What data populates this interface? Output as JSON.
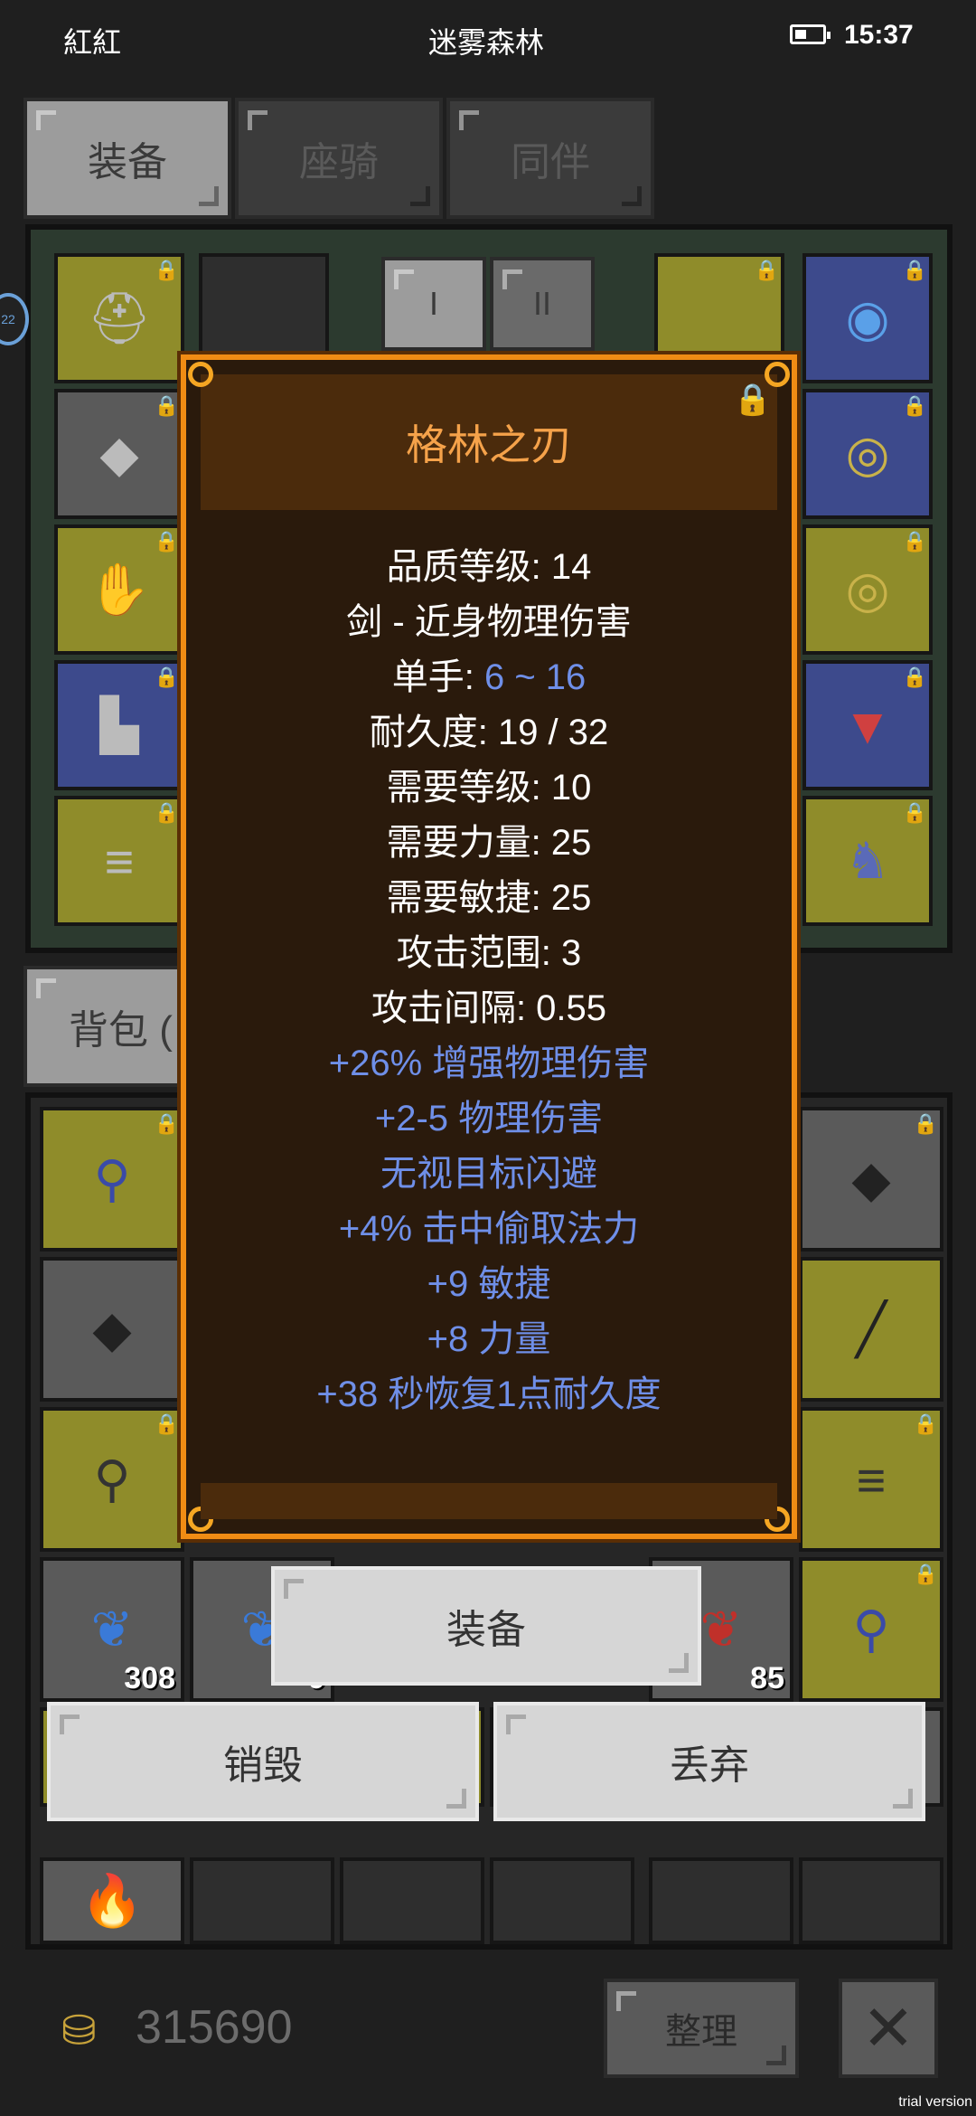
{
  "status_bar": {
    "player_name": "紅紅",
    "location": "迷雾森林",
    "time": "15:37"
  },
  "tabs": [
    {
      "label": "装备"
    },
    {
      "label": "座骑"
    },
    {
      "label": "同伴"
    }
  ],
  "equip_page_buttons": {
    "page1": "I",
    "page2": "II"
  },
  "bag_tab": {
    "label": "背包 ("
  },
  "side_badge": "22",
  "item_popup": {
    "name": "格林之刃",
    "quality_label": "品质等级: 14",
    "type_label": "剑 - 近身物理伤害",
    "hand_label": "单手: ",
    "damage": "6 ~ 16",
    "durability_label": "耐久度: 19 / 32",
    "req_level_label": "需要等级: 10",
    "req_str_label": "需要力量: 25",
    "req_dex_label": "需要敏捷: 25",
    "range_label": "攻击范围: 3",
    "interval_label": "攻击间隔: 0.55",
    "affixes": [
      "+26% 增强物理伤害",
      "+2-5 物理伤害",
      "无视目标闪避",
      "+4% 击中偷取法力",
      "+9 敏捷",
      "+8 力量",
      "+38 秒恢复1点耐久度"
    ]
  },
  "actions": {
    "equip": "装备",
    "destroy": "销毁",
    "discard": "丢弃"
  },
  "bag_counts": {
    "left_wing": "308",
    "second": "9",
    "red_wing": "85"
  },
  "gold": "315690",
  "sort_button": "整理",
  "watermark": "trial version",
  "colors": {
    "popup_border": "#f08c14",
    "title": "#f5a24a",
    "affix": "#6f8fe8"
  },
  "icons": {
    "close": "close-x-icon",
    "lock": "lock-icon",
    "gold": "gold-coins-icon",
    "battery": "battery-icon"
  }
}
